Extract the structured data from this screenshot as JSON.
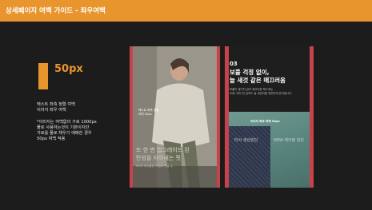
{
  "header": {
    "title": "상세페이지 여백 가이드 - 좌우여백"
  },
  "guide": {
    "px_label": "50px",
    "desc_lines": [
      "텍스트 좌측 정렬 여백",
      "이미지 좌우 여백"
    ],
    "note_lines": [
      "*이미지는 여백없이 가로 1000px",
      "풀로 사용하는것이 기본이지만",
      "가로를 풀로 채우기 애매한 경우",
      "50px 여백 적용"
    ]
  },
  "preview_left": {
    "small_lines": [
      "텍스트 좌측 정렬",
      "여백 50px"
    ],
    "big_lines": [
      "또 한 번 업그레이드 된",
      "탄성을 자아내는 핏"
    ],
    "foot": "NEW 레이블된 모델로 만날 수"
  },
  "preview_right": {
    "number": "03",
    "headline_lines": [
      "보풀 걱정 없이,",
      "늘 새것 같은 매끄러움"
    ],
    "sub_lines": [
      "보풀이 생기지 않아 매끄러운 텍스처는",
      "오래, 여러 번 입어도 늘 새것처럼 깨끗하게 유지됩니다."
    ],
    "fabric_label": "이미지 좌우 여백 50px",
    "tags": [
      "타사 생산원단",
      "NEW 레이블 원단"
    ]
  },
  "colors": {
    "accent": "#e8952e",
    "frame": "#c6434c",
    "background": "#1c1c1c"
  }
}
